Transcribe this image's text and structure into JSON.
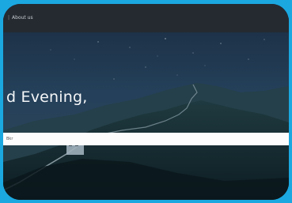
{
  "nav": {
    "separator": "|",
    "about_label": "About us"
  },
  "hero": {
    "greeting": "d Evening,"
  },
  "search": {
    "text": "Bkr"
  },
  "colors": {
    "outer_border": "#1ba8e0",
    "topbar": "#252a31",
    "sky": "#1d3349",
    "search_bg": "#fcfcfc"
  }
}
